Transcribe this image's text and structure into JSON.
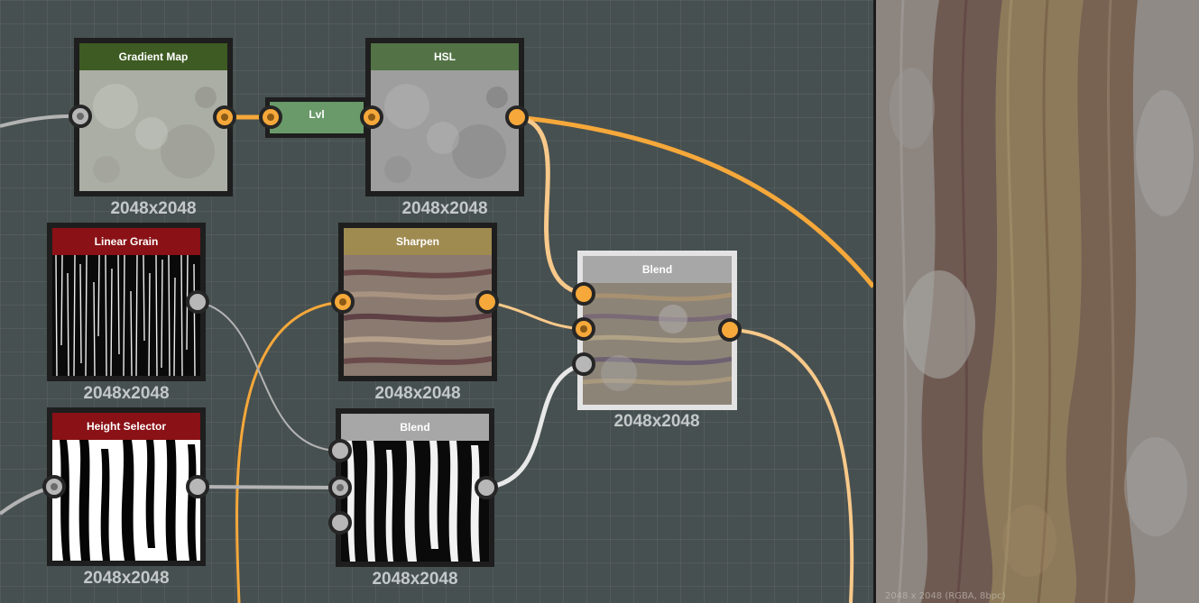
{
  "nodes": {
    "gradient_map": {
      "title": "Gradient Map",
      "resolution": "2048x2048",
      "title_color": "#3d5b22"
    },
    "hsl": {
      "title": "HSL",
      "resolution": "2048x2048",
      "title_color": "#537347"
    },
    "lvl": {
      "title": "Lvl"
    },
    "linear_grain": {
      "title": "Linear Grain",
      "resolution": "2048x2048",
      "title_color": "#8a1116"
    },
    "sharpen": {
      "title": "Sharpen",
      "resolution": "2048x2048",
      "title_color": "#9f8a50"
    },
    "blend_main": {
      "title": "Blend",
      "resolution": "2048x2048",
      "title_color": "#a7a7a7"
    },
    "height_selector": {
      "title": "Height Selector",
      "resolution": "2048x2048",
      "title_color": "#8a1116"
    },
    "blend_mask": {
      "title": "Blend",
      "resolution": "2048x2048",
      "title_color": "#a7a7a7"
    }
  },
  "preview": {
    "caption": "2048 x 2048 (RGBA, 8bpc)"
  },
  "colors": {
    "graph_bg": "#475050",
    "port_orange": "#f6a83a",
    "port_gray": "#b7b7b7",
    "wire_orange": "#f6a83a",
    "wire_light_orange": "#f8c98a",
    "wire_gray": "#b3b3b3",
    "wire_white": "#e8e8e8"
  }
}
